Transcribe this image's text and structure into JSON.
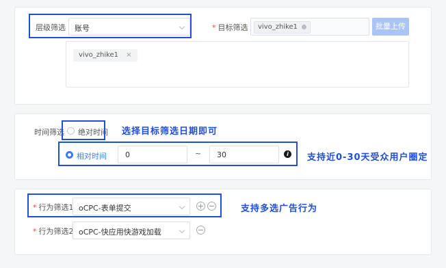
{
  "filter_card": {
    "level_label": "层级筛选",
    "level_value": "账号",
    "target_label": "目标筛选",
    "target_input_value": "vivo_zhike1",
    "bulk_upload_label": "批量上传",
    "selected_tag": "vivo_zhike1",
    "tag_remove": "×"
  },
  "time_card": {
    "time_label": "时间筛选",
    "absolute_label": "绝对时间",
    "relative_label": "相对时间",
    "range_start": "0",
    "range_separator": "~",
    "range_end": "30",
    "info_glyph": "i",
    "annotation_absolute": "选择目标筛选日期即可",
    "annotation_relative": "支持近0-30天受众用户圈定"
  },
  "behavior_card": {
    "behavior1_label": "行为筛选1",
    "behavior1_value": "oCPC-表单提交",
    "behavior2_label": "行为筛选2",
    "behavior2_value": "oCPC-快应用快游戏加载",
    "add_glyph": "+",
    "remove_glyph": "−",
    "annotation": "支持多选广告行为"
  },
  "colors": {
    "accent": "#3b7cff",
    "highlight": "#1f4fd8",
    "required": "#f0463c"
  }
}
